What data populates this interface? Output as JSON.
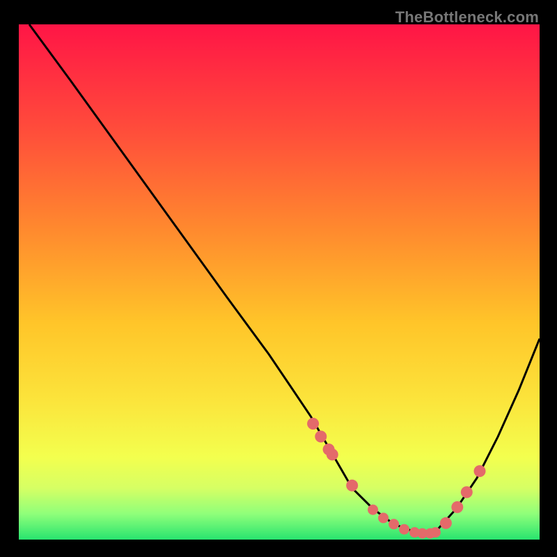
{
  "watermark": "TheBottleneck.com",
  "chart_data": {
    "type": "line",
    "title": "",
    "xlabel": "",
    "ylabel": "",
    "xlim": [
      0,
      100
    ],
    "ylim": [
      0,
      100
    ],
    "grid": false,
    "series": [
      {
        "name": "curve",
        "x": [
          2,
          10,
          20,
          30,
          40,
          48,
          52,
          56,
          60,
          64,
          68,
          72,
          76,
          80,
          84,
          88,
          92,
          96,
          100
        ],
        "y": [
          100,
          89,
          75,
          61,
          47,
          36,
          30,
          24,
          17,
          10,
          6,
          3,
          1.5,
          1.5,
          6,
          12,
          20,
          29,
          39
        ]
      }
    ],
    "markers": {
      "name": "dots",
      "x": [
        56.5,
        58,
        59.5,
        60.2,
        64,
        68,
        70,
        72,
        74,
        76,
        77.5,
        79,
        80,
        82,
        84.2,
        86,
        88.5
      ],
      "y": [
        22.5,
        20,
        17.5,
        16.5,
        10.5,
        5.8,
        4.2,
        3.0,
        2.0,
        1.4,
        1.2,
        1.2,
        1.4,
        3.2,
        6.3,
        9.2,
        13.3
      ]
    },
    "gradient_stops": [
      {
        "offset": 0.0,
        "color": "#ff1546"
      },
      {
        "offset": 0.2,
        "color": "#ff4b3b"
      },
      {
        "offset": 0.4,
        "color": "#ff8a2e"
      },
      {
        "offset": 0.58,
        "color": "#ffc529"
      },
      {
        "offset": 0.72,
        "color": "#fce23a"
      },
      {
        "offset": 0.84,
        "color": "#f3ff4e"
      },
      {
        "offset": 0.9,
        "color": "#d6ff64"
      },
      {
        "offset": 0.95,
        "color": "#8fff7a"
      },
      {
        "offset": 1.0,
        "color": "#28e46f"
      }
    ],
    "marker_color": "#e46a6a",
    "curve_color": "#000000"
  }
}
